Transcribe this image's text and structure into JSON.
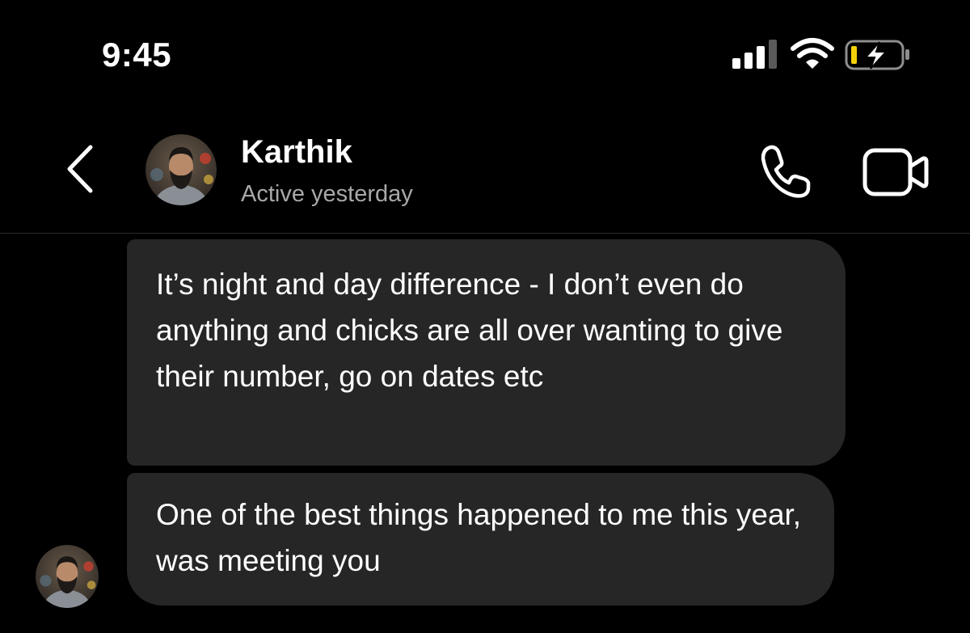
{
  "status_bar": {
    "time": "9:45",
    "signal_icon": "cellular-signal-icon",
    "wifi_icon": "wifi-icon",
    "battery_icon": "battery-charging-icon",
    "battery_color": "#f5d10a"
  },
  "header": {
    "back_icon": "chevron-left-icon",
    "contact_name": "Karthik",
    "contact_status": "Active yesterday",
    "call_icon": "phone-icon",
    "video_icon": "video-camera-icon"
  },
  "messages": [
    {
      "sender": "Karthik",
      "text": "It’s night and day difference - I don’t even do anything and chicks are all over wanting to give their number, go on dates etc"
    },
    {
      "sender": "Karthik",
      "text": "One of the best things happened to me this year, was meeting you"
    }
  ],
  "colors": {
    "background": "#000000",
    "bubble_incoming": "#262626",
    "secondary_text": "#a8a8a8"
  }
}
